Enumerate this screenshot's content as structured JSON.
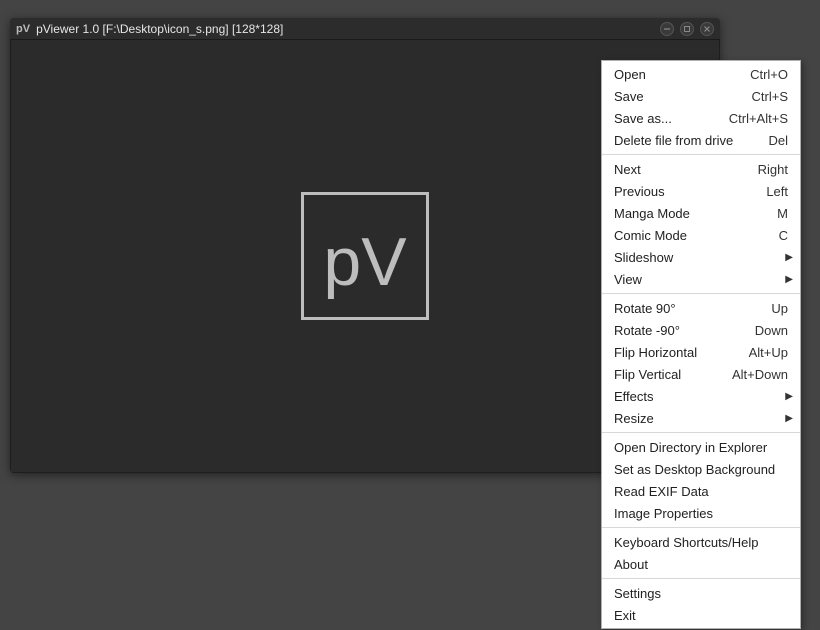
{
  "window": {
    "app_icon_text": "pV",
    "title": "pViewer 1.0 [F:\\Desktop\\icon_s.png] [128*128]",
    "image_text": "pV"
  },
  "menu": {
    "groups": [
      [
        {
          "label": "Open",
          "shortcut": "Ctrl+O"
        },
        {
          "label": "Save",
          "shortcut": "Ctrl+S"
        },
        {
          "label": "Save as...",
          "shortcut": "Ctrl+Alt+S"
        },
        {
          "label": "Delete file from drive",
          "shortcut": "Del"
        }
      ],
      [
        {
          "label": "Next",
          "shortcut": "Right"
        },
        {
          "label": "Previous",
          "shortcut": "Left"
        },
        {
          "label": "Manga Mode",
          "shortcut": "M"
        },
        {
          "label": "Comic Mode",
          "shortcut": "C"
        },
        {
          "label": "Slideshow",
          "submenu": true
        },
        {
          "label": "View",
          "submenu": true
        }
      ],
      [
        {
          "label": "Rotate 90°",
          "shortcut": "Up"
        },
        {
          "label": "Rotate -90°",
          "shortcut": "Down"
        },
        {
          "label": "Flip Horizontal",
          "shortcut": "Alt+Up"
        },
        {
          "label": "Flip Vertical",
          "shortcut": "Alt+Down"
        },
        {
          "label": "Effects",
          "submenu": true
        },
        {
          "label": "Resize",
          "submenu": true
        }
      ],
      [
        {
          "label": "Open Directory in Explorer"
        },
        {
          "label": "Set as Desktop Background"
        },
        {
          "label": "Read EXIF Data"
        },
        {
          "label": "Image Properties"
        }
      ],
      [
        {
          "label": "Keyboard Shortcuts/Help"
        },
        {
          "label": "About"
        }
      ],
      [
        {
          "label": "Settings"
        },
        {
          "label": "Exit"
        }
      ]
    ]
  }
}
